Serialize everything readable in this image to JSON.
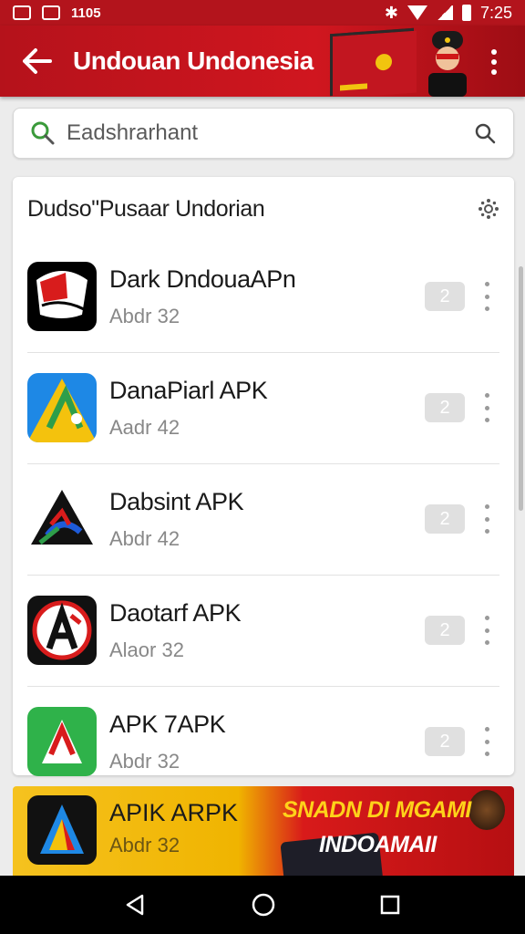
{
  "status_bar": {
    "carrier_text": "1105",
    "time": "7:25"
  },
  "app_bar": {
    "title": "Undouan Undonesia",
    "back_icon": "arrow-back-icon",
    "menu_icon": "more-vert-icon"
  },
  "search": {
    "placeholder": "Eadshrarhant",
    "value": ""
  },
  "section": {
    "title": "Dudso\"Pusaar Undorian",
    "settings_icon": "gear-icon"
  },
  "apps": [
    {
      "name": "Dark DndouaAPn",
      "sub": "Abdr 32",
      "badge": "2",
      "icon": "dark-app-icon",
      "icon_bg": "#000000"
    },
    {
      "name": "DanaPiarl APK",
      "sub": "Aadr 42",
      "badge": "2",
      "icon": "dana-app-icon",
      "icon_bg": "#1e88e5"
    },
    {
      "name": "Dabsint APK",
      "sub": "Abdr 42",
      "badge": "2",
      "icon": "dabsint-app-icon",
      "icon_bg": "#ffffff"
    },
    {
      "name": "Daotarf APK",
      "sub": "Alaor 32",
      "badge": "2",
      "icon": "daotarf-app-icon",
      "icon_bg": "#111111"
    },
    {
      "name": "APK 7APK",
      "sub": "Abdr 32",
      "badge": "2",
      "icon": "apk7-app-icon",
      "icon_bg": "#2fb24a"
    }
  ],
  "banner": {
    "app_name": "APIK ARPK",
    "app_sub": "Abdr 32",
    "headline": "SNADN DI MGAMI",
    "subline": "INDOAMAII",
    "icon": "apik-app-icon"
  },
  "nav": {
    "back": "nav-back-icon",
    "home": "nav-home-icon",
    "recents": "nav-recents-icon"
  },
  "colors": {
    "primary": "#c4141c",
    "badge": "#e0e0e0",
    "banner_yellow": "#f5c21f"
  }
}
